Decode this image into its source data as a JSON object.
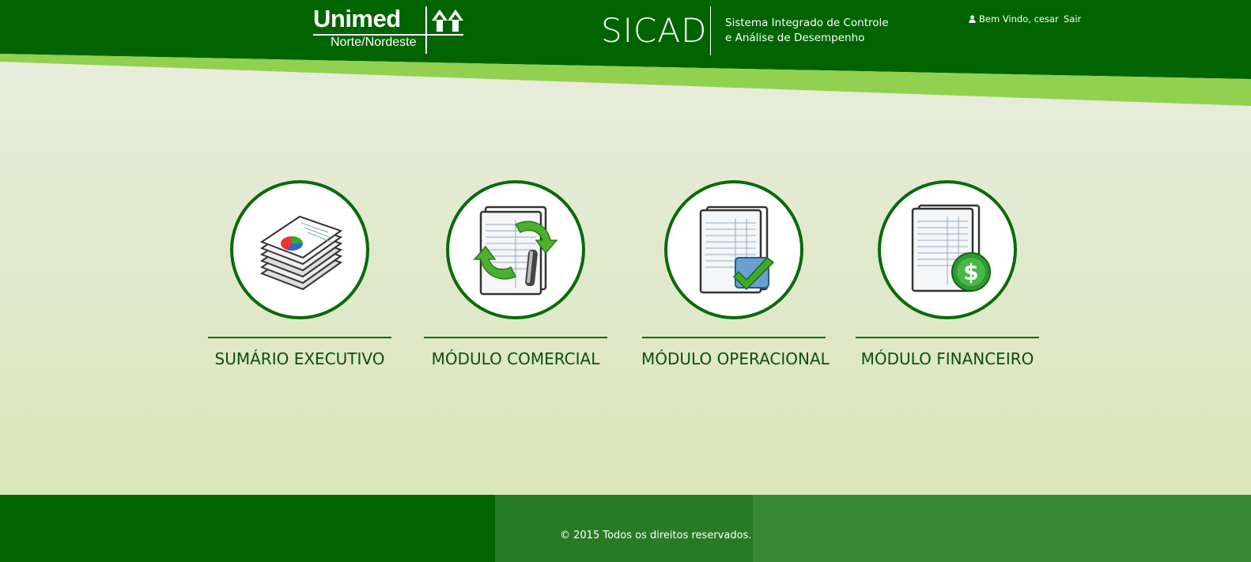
{
  "header": {
    "logo_text": "Unimed",
    "logo_subtext": "Norte/Nordeste",
    "app_name": "SICAD",
    "app_description_line1": "Sistema Integrado de Controle",
    "app_description_line2": "e Análise de Desempenho",
    "welcome_text": "Bem Vindo, cesar",
    "logout_label": "Sair",
    "user_icon": "user-icon"
  },
  "modules": [
    {
      "label": "SUMÁRIO EXECUTIVO",
      "icon": "report-pie-chart-icon"
    },
    {
      "label": "MÓDULO COMERCIAL",
      "icon": "document-refresh-pen-icon"
    },
    {
      "label": "MÓDULO OPERACIONAL",
      "icon": "document-check-icon"
    },
    {
      "label": "MÓDULO FINANCEIRO",
      "icon": "document-dollar-icon"
    }
  ],
  "footer": {
    "copyright": "© 2015 Todos os direitos reservados."
  },
  "colors": {
    "header_green": "#006400",
    "accent_light_green": "#92d050",
    "module_border": "#0b6a0b",
    "label_green": "#0e4f0e",
    "footer_mid": "#277b25",
    "footer_right": "#388a35"
  }
}
